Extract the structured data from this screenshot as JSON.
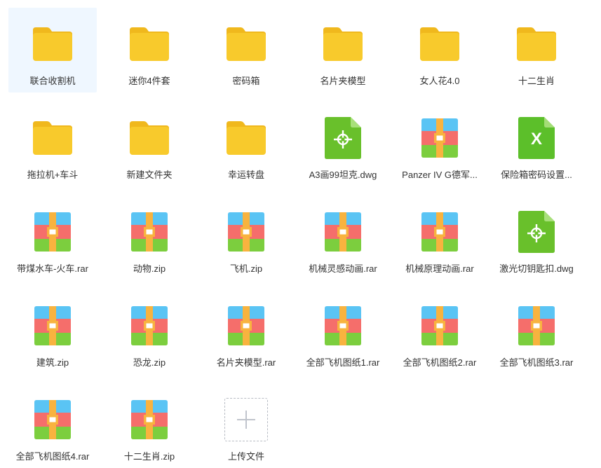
{
  "colors": {
    "folder": "#f8ca2c",
    "folder_tab": "#f0b81d",
    "dwg": "#69c02b",
    "xls": "#5cbf2a",
    "archive_blue": "#5ac4f4",
    "archive_red": "#f56e6b",
    "archive_green": "#7cce3e",
    "archive_strap": "#f8b33f",
    "selected_bg": "#eff7ff"
  },
  "files": [
    {
      "name": "联合收割机",
      "type": "folder",
      "selected": true
    },
    {
      "name": "迷你4件套",
      "type": "folder"
    },
    {
      "name": "密码箱",
      "type": "folder"
    },
    {
      "name": "名片夹模型",
      "type": "folder"
    },
    {
      "name": "女人花4.0",
      "type": "folder"
    },
    {
      "name": "十二生肖",
      "type": "folder"
    },
    {
      "name": "拖拉机+车斗",
      "type": "folder"
    },
    {
      "name": "新建文件夹",
      "type": "folder"
    },
    {
      "name": "幸运转盘",
      "type": "folder"
    },
    {
      "name": "A3画99坦克.dwg",
      "type": "dwg"
    },
    {
      "name": "Panzer IV G德军...",
      "type": "archive"
    },
    {
      "name": "保险箱密码设置...",
      "type": "xls"
    },
    {
      "name": "带煤水车-火车.rar",
      "type": "archive"
    },
    {
      "name": "动物.zip",
      "type": "archive"
    },
    {
      "name": "飞机.zip",
      "type": "archive"
    },
    {
      "name": "机械灵感动画.rar",
      "type": "archive"
    },
    {
      "name": "机械原理动画.rar",
      "type": "archive"
    },
    {
      "name": "激光切钥匙扣.dwg",
      "type": "dwg"
    },
    {
      "name": "建筑.zip",
      "type": "archive"
    },
    {
      "name": "恐龙.zip",
      "type": "archive"
    },
    {
      "name": "名片夹模型.rar",
      "type": "archive"
    },
    {
      "name": "全部飞机图纸1.rar",
      "type": "archive"
    },
    {
      "name": "全部飞机图纸2.rar",
      "type": "archive"
    },
    {
      "name": "全部飞机图纸3.rar",
      "type": "archive"
    },
    {
      "name": "全部飞机图纸4.rar",
      "type": "archive"
    },
    {
      "name": "十二生肖.zip",
      "type": "archive"
    }
  ],
  "upload": {
    "label": "上传文件",
    "icon": "plus-icon"
  },
  "xls_glyph": "X"
}
